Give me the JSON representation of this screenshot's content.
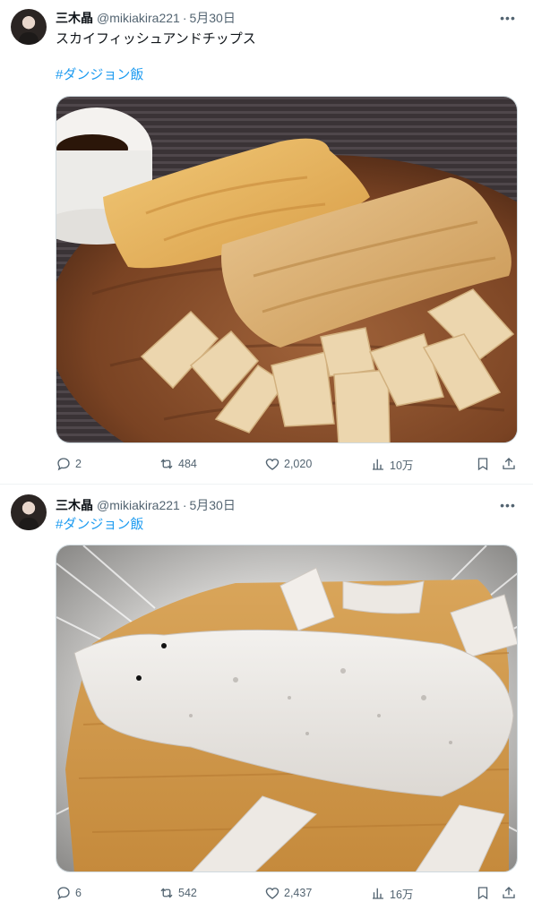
{
  "tweets": [
    {
      "author_name": "三木晶",
      "handle": "@mikiakira221",
      "separator": "·",
      "date": "5月30日",
      "text": "スカイフィッシュアンドチップス",
      "hashtag": "#ダンジョン飯",
      "replies": "2",
      "retweets": "484",
      "likes": "2,020",
      "views": "10万"
    },
    {
      "author_name": "三木晶",
      "handle": "@mikiakira221",
      "separator": "·",
      "date": "5月30日",
      "hashtag": "#ダンジョン飯",
      "replies": "6",
      "retweets": "542",
      "likes": "2,437",
      "views": "16万"
    }
  ],
  "more_glyph": "•••"
}
